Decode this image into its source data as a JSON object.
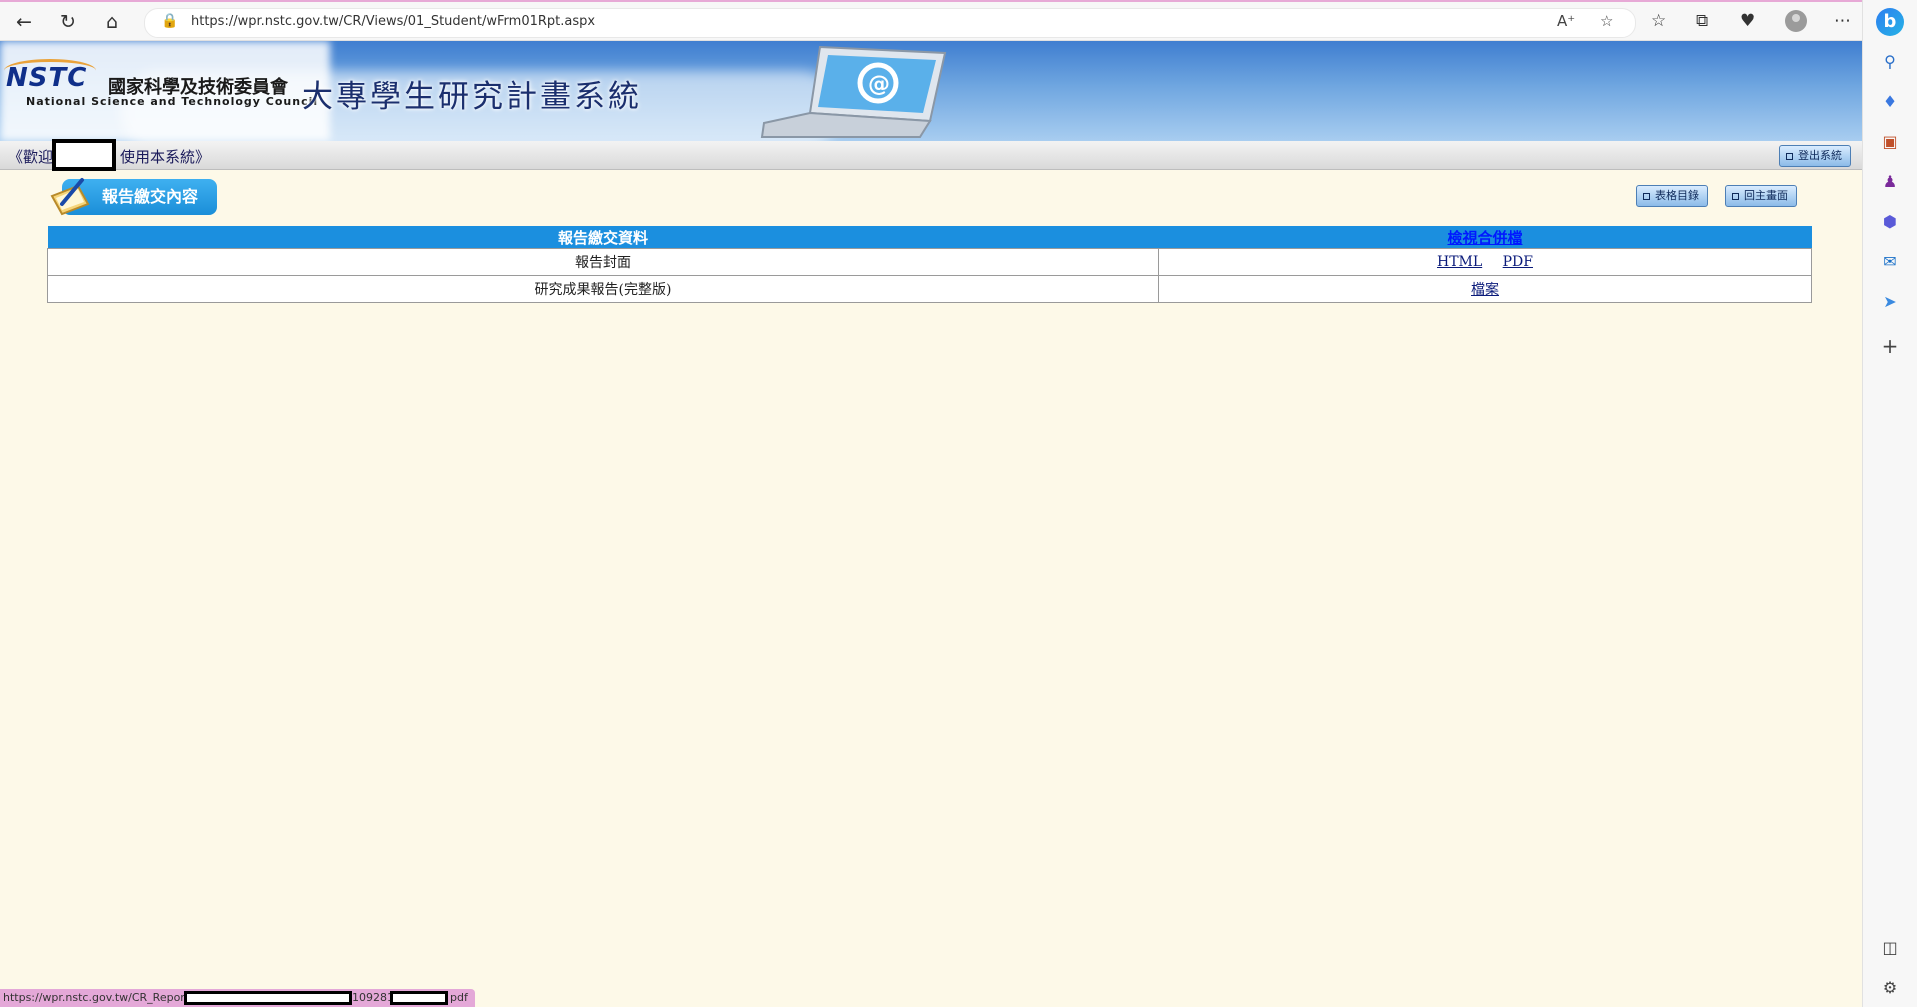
{
  "browser": {
    "url": "https://wpr.nstc.gov.tw/CR/Views/01_Student/wFrm01Rpt.aspx",
    "status_url_prefix": "https://wpr.nstc.gov.tw/CR_Report",
    "status_url_mid": "109281",
    "status_url_suffix": "pdf"
  },
  "banner": {
    "logo_mark": "NSTC",
    "logo_cn": "國家科學及技術委員會",
    "logo_en": "National Science and Technology Council",
    "system_title": "大專學生研究計畫系統"
  },
  "welcome": {
    "prefix": "《歡迎",
    "suffix": "使用本系統》",
    "logout_label": "登出系統"
  },
  "page": {
    "heading": "報告繳交內容",
    "btn_forms": "表格目錄",
    "btn_home": "回主畫面"
  },
  "table": {
    "col1_header": "報告繳交資料",
    "col2_header": "檢視合併檔",
    "rows": [
      {
        "label": "報告封面",
        "link1": "HTML",
        "link2": "PDF"
      },
      {
        "label": "研究成果報告(完整版)",
        "link1": "檔案"
      }
    ]
  },
  "colors": {
    "table_header": "#1b8fdf",
    "page_bg": "#fdf9e8"
  }
}
